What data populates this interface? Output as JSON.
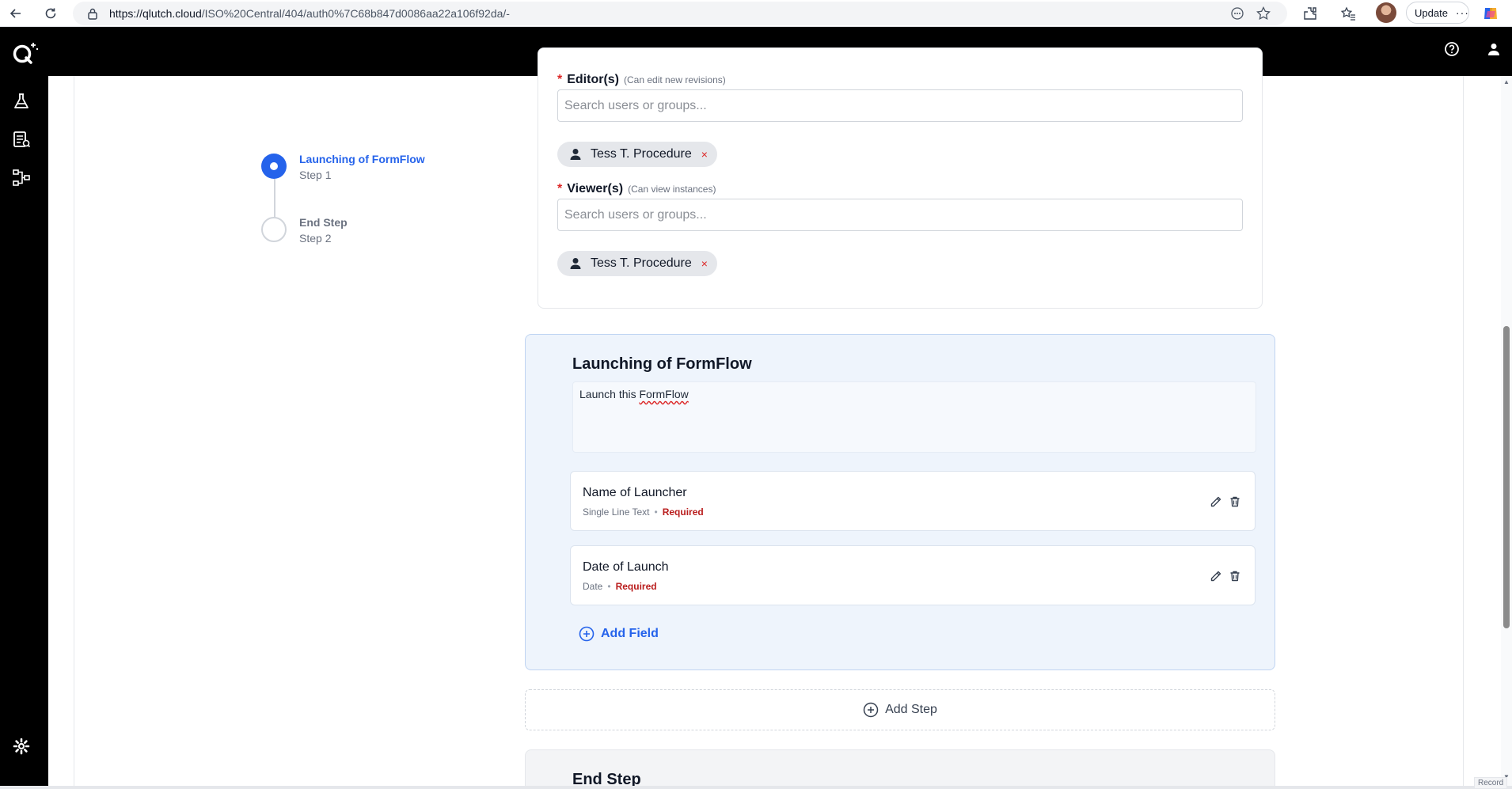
{
  "browser": {
    "url_host": "https://qlutch.cloud",
    "url_path": "/ISO%20Central/404/auth0%7C68b847d0086aa22a106f92da/-",
    "update_label": "Update",
    "update_more": "···"
  },
  "stepper": {
    "steps": [
      {
        "title": "Launching of FormFlow",
        "subtitle": "Step 1",
        "state": "active"
      },
      {
        "title": "End Step",
        "subtitle": "Step 2",
        "state": "inactive"
      }
    ]
  },
  "permissions": {
    "editors": {
      "label": "Editor(s)",
      "hint": "(Can edit new revisions)",
      "required_mark": "*",
      "placeholder": "Search users or groups...",
      "chips": [
        "Tess T. Procedure"
      ]
    },
    "viewers": {
      "label": "Viewer(s)",
      "hint": "(Can view instances)",
      "required_mark": "*",
      "placeholder": "Search users or groups...",
      "chips": [
        "Tess T. Procedure"
      ]
    },
    "chip_remove": "×"
  },
  "step_card": {
    "title": "Launching of FormFlow",
    "description_prefix": "Launch this ",
    "description_word": "FormFlow",
    "fields": [
      {
        "name": "Name of Launcher",
        "type": "Single Line Text",
        "required": "Required"
      },
      {
        "name": "Date of Launch",
        "type": "Date",
        "required": "Required"
      }
    ],
    "meta_separator": "•",
    "add_field_label": "Add Field"
  },
  "add_step_label": "Add Step",
  "end_card": {
    "title": "End Step"
  },
  "record_label": "Record",
  "colors": {
    "accent": "#2563eb",
    "required": "#b91c1c",
    "app_bar": "#000000"
  }
}
